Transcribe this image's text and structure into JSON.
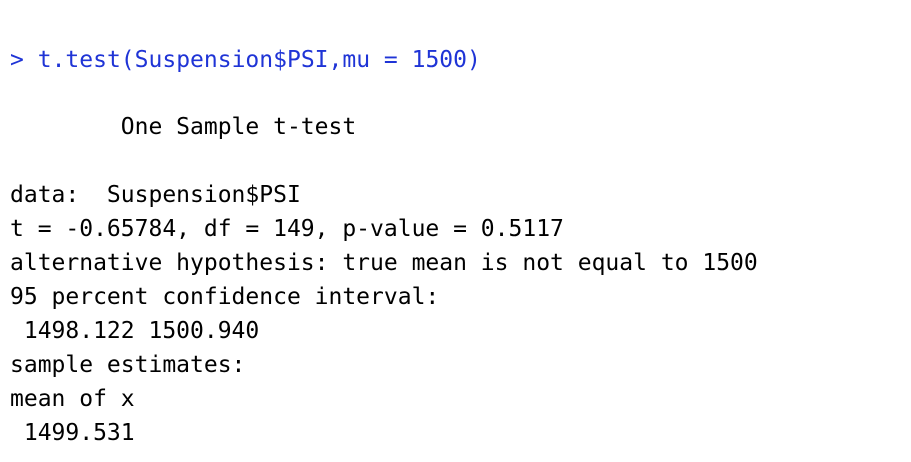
{
  "colors": {
    "command": "#1f34d6",
    "output": "#000000",
    "background": "#ffffff"
  },
  "console": {
    "prompt": ">",
    "command": "t.test(Suspension$PSI,mu = 1500)",
    "output": {
      "title": "        One Sample t-test",
      "data_line": "data:  Suspension$PSI",
      "stats_line": "t = -0.65784, df = 149, p-value = 0.5117",
      "alternative_line": "alternative hypothesis: true mean is not equal to 1500",
      "ci_header": "95 percent confidence interval:",
      "ci_values": " 1498.122 1500.940",
      "estimates_header": "sample estimates:",
      "estimate_label": "mean of x",
      "estimate_value": " 1499.531"
    }
  }
}
